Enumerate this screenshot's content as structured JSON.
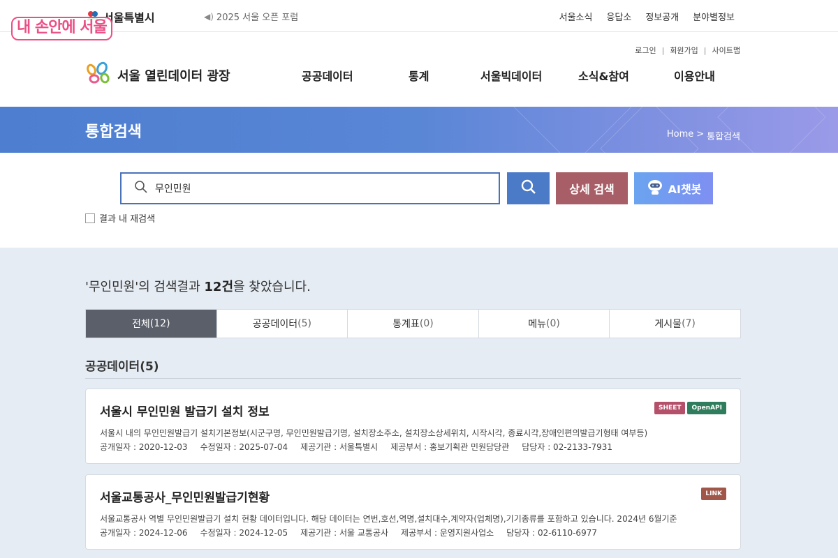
{
  "watermark": "내 손안에 서울",
  "top": {
    "gov_logo": "서울특별시",
    "notice": "2025 서울 오픈 포럼",
    "links": [
      "서울소식",
      "응답소",
      "정보공개",
      "분야별정보"
    ]
  },
  "header": {
    "user_links": [
      "로그인",
      "회원가입",
      "사이트맵"
    ],
    "site_name": "서울 열린데이터 광장",
    "gnb": [
      "공공데이터",
      "통계",
      "서울빅데이터",
      "소식&참여",
      "이용안내"
    ]
  },
  "banner": {
    "title": "통합검색",
    "breadcrumb_home": "Home",
    "breadcrumb_sep": ">",
    "breadcrumb_current": "통합검색"
  },
  "search": {
    "value": "무인민원",
    "detail_label": "상세 검색",
    "ai_label": "AI챗봇",
    "resub_label": "결과 내 재검색"
  },
  "results": {
    "summary_pre": "'무인민원'의 검색결과 ",
    "summary_count": "12건",
    "summary_post": "을 찾았습니다.",
    "tabs": [
      {
        "label": "전체",
        "count": "(12)"
      },
      {
        "label": "공공데이터",
        "count": "(5)"
      },
      {
        "label": "통계표",
        "count": "(0)"
      },
      {
        "label": "메뉴",
        "count": "(0)"
      },
      {
        "label": "게시물",
        "count": "(7)"
      }
    ],
    "section_title": "공공데이터(5)",
    "items": [
      {
        "title": "서울시 무인민원 발급기 설치 정보",
        "desc": "서울시 내의 무인민원발급기 설치기본정보(시군구명, 무인민원발급기명, 설치장소주소, 설치장소상세위치, 시작시각, 종료시각,장애인편의발급기형태 여부등)",
        "meta": [
          "공개일자 : 2020-12-03",
          "수정일자 : 2025-07-04",
          "제공기관 : 서울특별시",
          "제공부서 : 홍보기획관 민원담당관",
          "담당자 : 02-2133-7931"
        ],
        "badges": [
          {
            "label": "SHEET",
            "color": "#b5506a"
          },
          {
            "label": "OpenAPI",
            "color": "#2f7d5c"
          }
        ]
      },
      {
        "title": "서울교통공사_무인민원발급기현황",
        "desc": "서울교통공사 역별 무인민원발급기 설치 현황 데이터입니다. 해당 데이터는 연번,호선,역명,설치대수,계약자(업체명),기기종류를 포함하고 있습니다. 2024년 6월기준",
        "meta": [
          "공개일자 : 2024-12-06",
          "수정일자 : 2024-12-05",
          "제공기관 : 서울 교통공사",
          "제공부서 : 운영지원사업소",
          "담당자 : 02-6110-6977"
        ],
        "badges": [
          {
            "label": "LINK",
            "color": "#a0574a"
          }
        ]
      }
    ]
  }
}
